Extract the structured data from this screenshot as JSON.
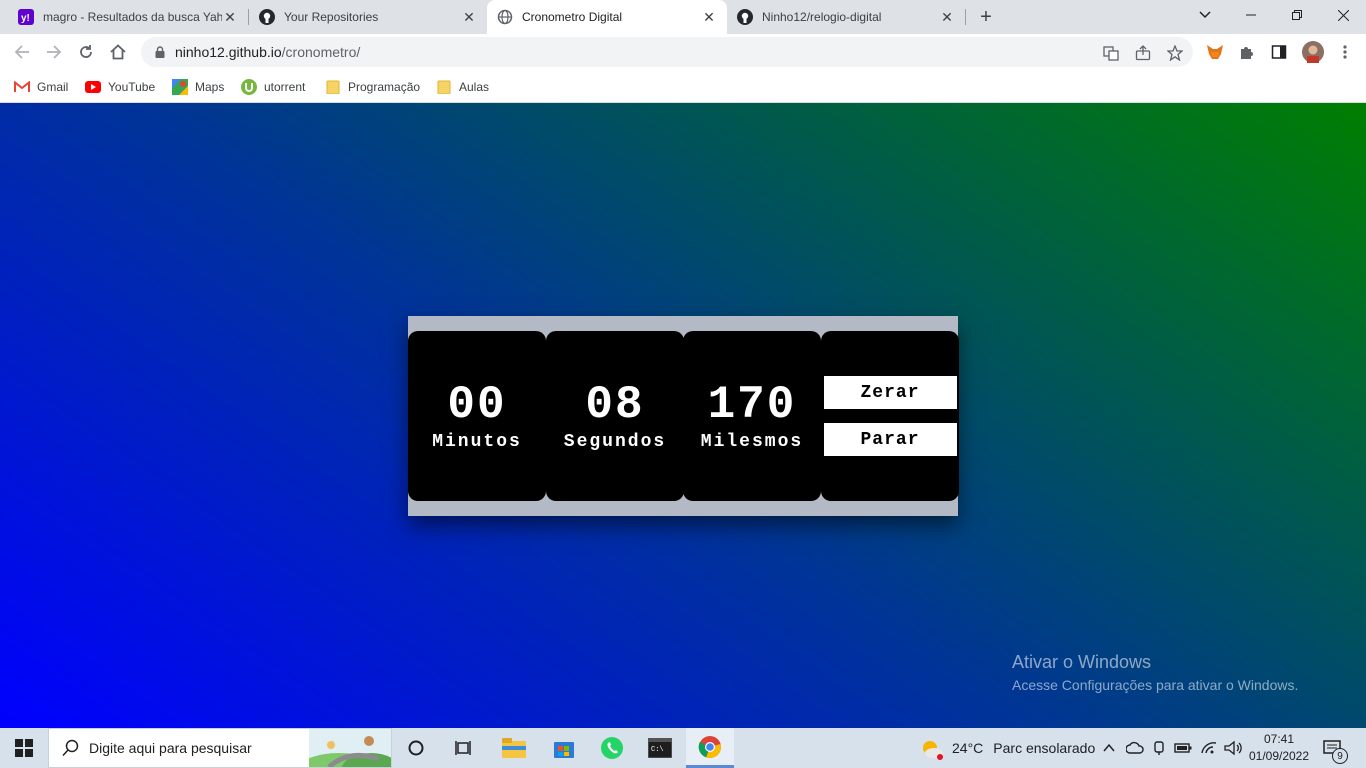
{
  "browser": {
    "tabs": [
      {
        "title": "magro - Resultados da busca Yah",
        "icon": "yahoo-icon"
      },
      {
        "title": "Your Repositories",
        "icon": "github-icon"
      },
      {
        "title": "Cronometro Digital",
        "icon": "globe-icon",
        "active": true
      },
      {
        "title": "Ninho12/relogio-digital",
        "icon": "github-icon"
      }
    ],
    "url_domain": "ninho12.github.io",
    "url_path": "/cronometro/",
    "bookmarks": [
      {
        "label": "Gmail",
        "icon": "gmail-icon"
      },
      {
        "label": "YouTube",
        "icon": "youtube-icon"
      },
      {
        "label": "Maps",
        "icon": "maps-icon"
      },
      {
        "label": "utorrent",
        "icon": "utorrent-icon"
      },
      {
        "label": "Programação",
        "icon": "folder-icon"
      },
      {
        "label": "Aulas",
        "icon": "folder-icon"
      }
    ]
  },
  "stopwatch": {
    "minutes": "00",
    "minutes_label": "Minutos",
    "seconds": "08",
    "seconds_label": "Segundos",
    "millis": "170",
    "millis_label": "Milesmos",
    "reset_label": "Zerar",
    "stop_label": "Parar"
  },
  "watermark": {
    "title": "Ativar o Windows",
    "subtitle": "Acesse Configurações para ativar o Windows."
  },
  "taskbar": {
    "search_placeholder": "Digite aqui para pesquisar",
    "weather_temp": "24°C",
    "weather_text": "Parc ensolarado",
    "time": "07:41",
    "date": "01/09/2022",
    "notifications": "9"
  },
  "colors": {
    "gradient_start": "#0000ff",
    "gradient_end": "#007f00",
    "panel": "#b4b9c6"
  }
}
